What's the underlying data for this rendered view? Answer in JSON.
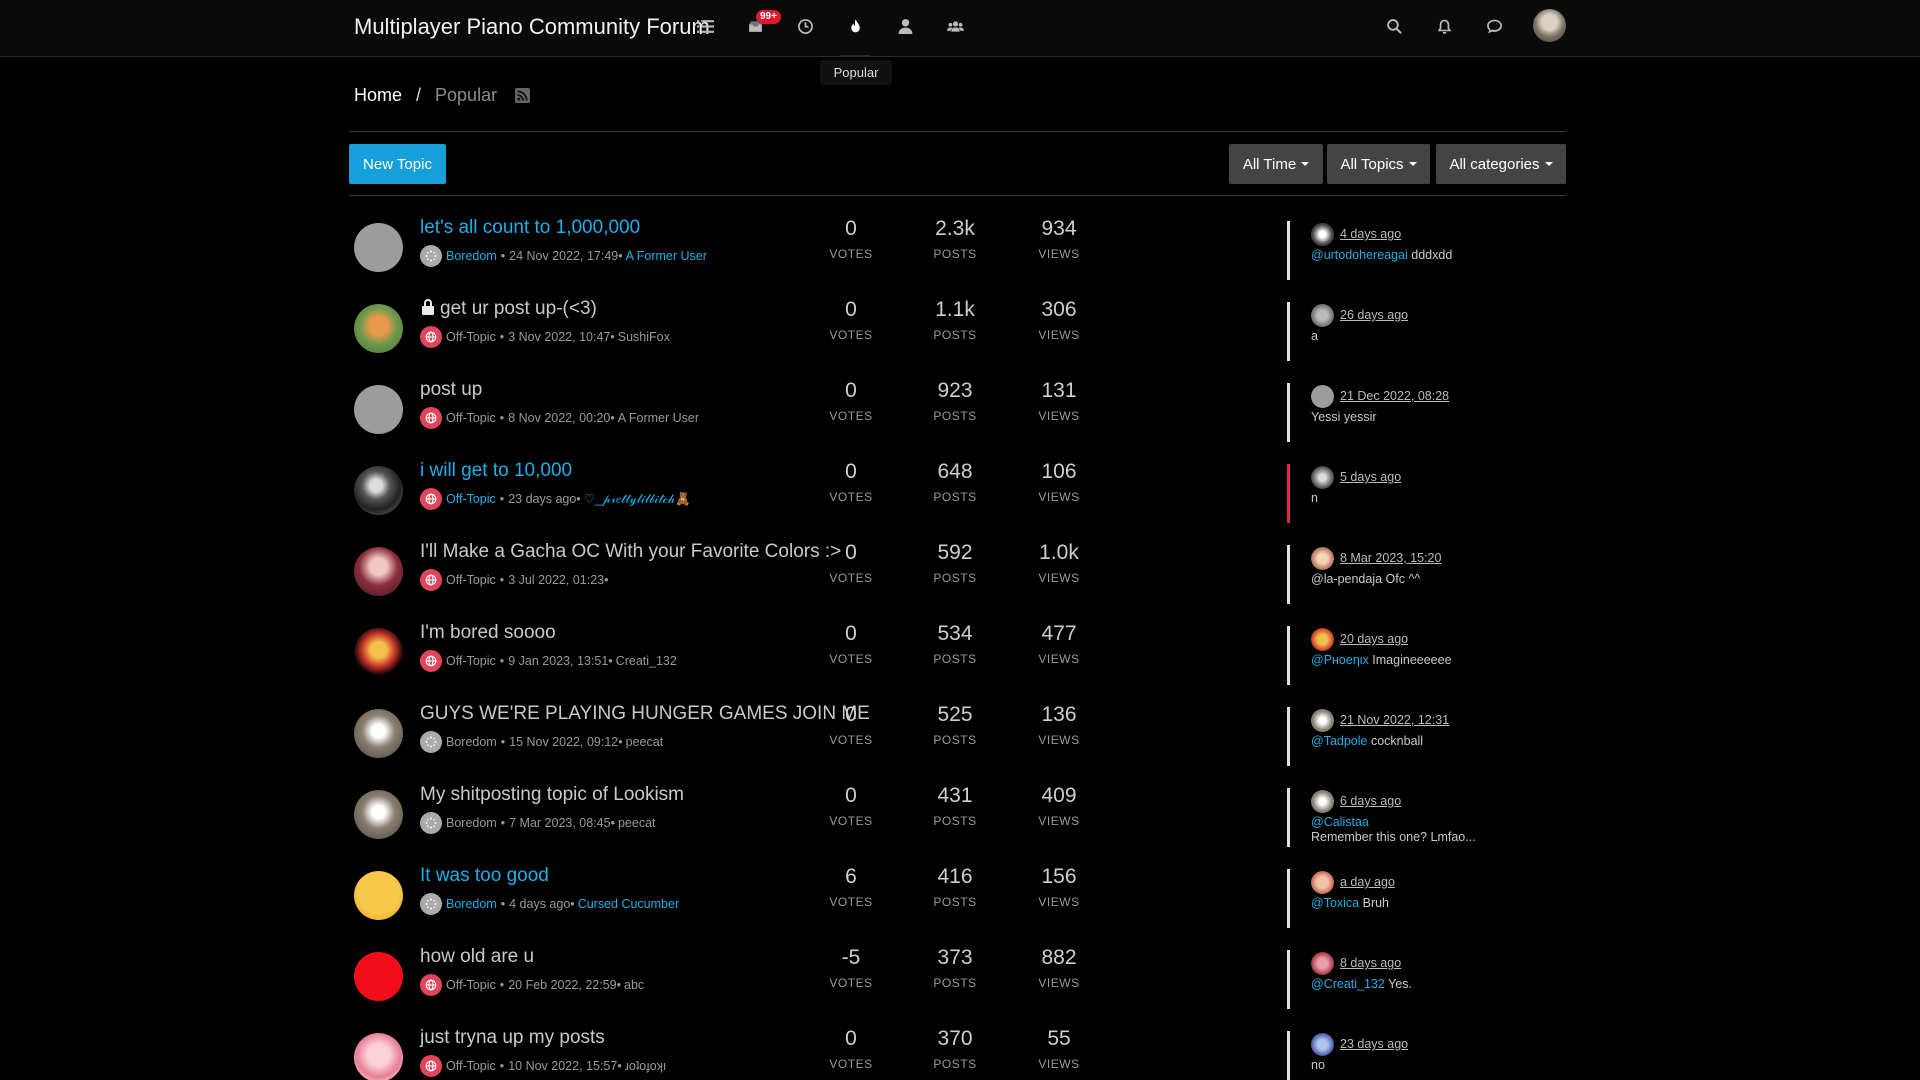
{
  "header": {
    "title": "Multiplayer Piano Community Forum",
    "unread_badge": "99+",
    "tooltip": "Popular"
  },
  "breadcrumb": {
    "home": "Home",
    "separator": "/",
    "current": "Popular"
  },
  "toolbar": {
    "new_topic": "New Topic",
    "filters": [
      "All Time",
      "All Topics",
      "All categories"
    ]
  },
  "labels": {
    "votes": "VOTES",
    "posts": "POSTS",
    "views": "VIEWS"
  },
  "colors": {
    "accent": "#1eaee8",
    "badge": "#e0182d",
    "offtopic": "#e1455b",
    "boredom": "#aaaaaa",
    "unread_bar": "#e32b3c"
  },
  "topics": [
    {
      "title": "let's all count to 1,000,000",
      "unread": true,
      "locked": false,
      "category": "Boredom",
      "category_icon": "boredom",
      "date": "24 Nov 2022, 17:49",
      "author": "A Former User",
      "votes": "0",
      "posts": "2.3k",
      "views": "934",
      "last_time": "4 days ago",
      "last_user": "@urtodohereagai",
      "last_text": "dddxdd",
      "last_text2": ""
    },
    {
      "title": "get ur post up-(<3)",
      "unread": false,
      "locked": true,
      "category": "Off-Topic",
      "category_icon": "offtopic",
      "date": "3 Nov 2022, 10:47",
      "author": "SushiFox",
      "votes": "0",
      "posts": "1.1k",
      "views": "306",
      "last_time": "26 days ago",
      "last_user": "",
      "last_text": "a",
      "last_text2": ""
    },
    {
      "title": "post up",
      "unread": false,
      "locked": false,
      "category": "Off-Topic",
      "category_icon": "offtopic",
      "date": "8 Nov 2022, 00:20",
      "author": "A Former User",
      "votes": "0",
      "posts": "923",
      "views": "131",
      "last_time": "21 Dec 2022, 08:28",
      "last_user": "",
      "last_text": "Yessi yessir",
      "last_text2": ""
    },
    {
      "title": "i will get to 10,000",
      "unread": true,
      "locked": false,
      "category": "Off-Topic",
      "category_icon": "offtopic",
      "date": "23 days ago",
      "author": "♡_𝓅𝓇𝑒𝓉𝓉𝓎𝓁𝒾𝓁𝒷𝒾𝓉𝒸𝒽🧸",
      "votes": "0",
      "posts": "648",
      "views": "106",
      "last_time": "5 days ago",
      "last_user": "",
      "last_text": "n",
      "last_text2": ""
    },
    {
      "title": "I'll Make a Gacha OC With your Favorite Colors :>",
      "unread": false,
      "locked": false,
      "category": "Off-Topic",
      "category_icon": "offtopic",
      "date": "3 Jul 2022, 01:23",
      "author": "",
      "votes": "0",
      "posts": "592",
      "views": "1.0k",
      "last_time": "8 Mar 2023, 15:20",
      "last_user": "",
      "last_text": "@la-pendaja Ofc ^^",
      "last_text2": ""
    },
    {
      "title": "I'm bored soooo",
      "unread": false,
      "locked": false,
      "category": "Off-Topic",
      "category_icon": "offtopic",
      "date": "9 Jan 2023, 13:51",
      "author": "Creati_132",
      "votes": "0",
      "posts": "534",
      "views": "477",
      "last_time": "20 days ago",
      "last_user": "@Pнoeηιx",
      "last_text": "Imagineeeeee",
      "last_text2": ""
    },
    {
      "title": "GUYS WE'RE PLAYING HUNGER GAMES JOIN ME",
      "unread": false,
      "locked": false,
      "category": "Boredom",
      "category_icon": "boredom",
      "date": "15 Nov 2022, 09:12",
      "author": "peecat",
      "votes": "0",
      "posts": "525",
      "views": "136",
      "last_time": "21 Nov 2022, 12:31",
      "last_user": "@Tadpole",
      "last_text": "cocknball",
      "last_text2": ""
    },
    {
      "title": "My shitposting topic of Lookism",
      "unread": false,
      "locked": false,
      "category": "Boredom",
      "category_icon": "boredom",
      "date": "7 Mar 2023, 08:45",
      "author": "peecat",
      "votes": "0",
      "posts": "431",
      "views": "409",
      "last_time": "6 days ago",
      "last_user": "@Calistaa",
      "last_text": "",
      "last_text2": "Remember this one? Lmfao..."
    },
    {
      "title": "It was too good",
      "unread": true,
      "locked": false,
      "category": "Boredom",
      "category_icon": "boredom",
      "date": "4 days ago",
      "author": "Cursed Cucumber",
      "votes": "6",
      "posts": "416",
      "views": "156",
      "last_time": "a day ago",
      "last_user": "@Toxica",
      "last_text": "Bruh",
      "last_text2": ""
    },
    {
      "title": "how old are u",
      "unread": false,
      "locked": false,
      "category": "Off-Topic",
      "category_icon": "offtopic",
      "date": "20 Feb 2022, 22:59",
      "author": "abc",
      "votes": "-5",
      "posts": "373",
      "views": "882",
      "last_time": "8 days ago",
      "last_user": "@Creati_132",
      "last_text": "Yes.",
      "last_text2": ""
    },
    {
      "title": "just tryna up my posts",
      "unread": false,
      "locked": false,
      "category": "Off-Topic",
      "category_icon": "offtopic",
      "date": "10 Nov 2022, 15:57",
      "author": "ɹoʇoɟoʞı",
      "votes": "0",
      "posts": "370",
      "views": "55",
      "last_time": "23 days ago",
      "last_user": "",
      "last_text": "no",
      "last_text2": ""
    }
  ]
}
